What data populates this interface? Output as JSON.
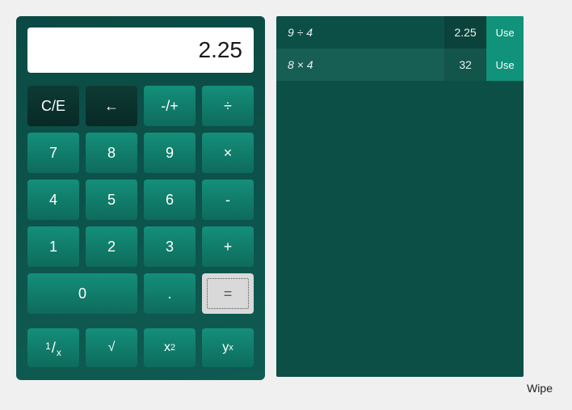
{
  "display": "2.25",
  "buttons": {
    "clear": "C/E",
    "back": "←",
    "negate": "-/+",
    "divide": "÷",
    "d7": "7",
    "d8": "8",
    "d9": "9",
    "multiply": "×",
    "d4": "4",
    "d5": "5",
    "d6": "6",
    "minus": "-",
    "d1": "1",
    "d2": "2",
    "d3": "3",
    "plus": "+",
    "d0": "0",
    "dot": ".",
    "equals": "="
  },
  "sci": {
    "reciprocal_num": "1",
    "reciprocal_slash": "/",
    "reciprocal_den": "x",
    "sqrt": "√",
    "square_base": "x",
    "square_exp": "2",
    "pow_base": "y",
    "pow_exp": "x"
  },
  "history": [
    {
      "expr": "9 ÷ 4",
      "result": "2.25",
      "use": "Use"
    },
    {
      "expr": "8 × 4",
      "result": "32",
      "use": "Use"
    }
  ],
  "wipe": "Wipe"
}
